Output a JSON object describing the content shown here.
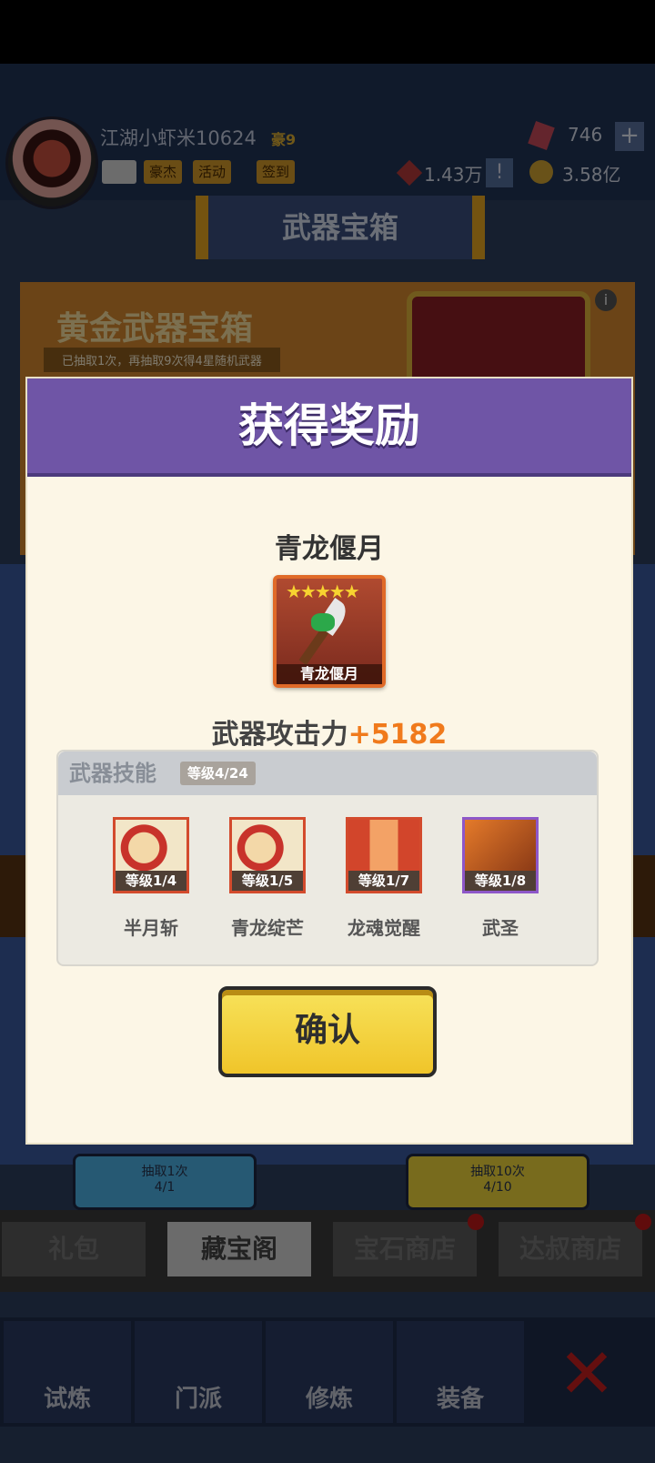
{
  "header": {
    "username": "江湖小虾米10624",
    "vip": "豪9",
    "chips": [
      "豪杰",
      "活动",
      "签到"
    ],
    "gems": "746",
    "plus_label": "+",
    "power": "1.43万",
    "alert": "!",
    "coins": "3.58亿"
  },
  "page": {
    "title": "武器宝箱",
    "chest_title": "黄金武器宝箱",
    "chest_sub": "已抽取1次，再抽取9次得4星随机武器",
    "info": "i"
  },
  "draw": {
    "single": {
      "label": "抽取1次",
      "count": "4/1"
    },
    "ten": {
      "label": "抽取10次",
      "count": "4/10"
    }
  },
  "tabs": [
    "礼包",
    "藏宝阁",
    "宝石商店",
    "达叔商店"
  ],
  "bottom_nav": [
    "试炼",
    "门派",
    "修炼",
    "装备"
  ],
  "modal": {
    "title": "获得奖励",
    "weapon_name": "青龙偃月",
    "card_stars": "★★★★★",
    "card_caption": "青龙偃月",
    "atk_label": "武器攻击力",
    "atk_value": "+5182",
    "skills_title": "武器技能",
    "skills_level": "等级4/24",
    "skills": [
      {
        "name": "半月斩",
        "level": "等级1/4"
      },
      {
        "name": "青龙绽芒",
        "level": "等级1/5"
      },
      {
        "name": "龙魂觉醒",
        "level": "等级1/7"
      },
      {
        "name": "武圣",
        "level": "等级1/8"
      }
    ],
    "confirm": "确认"
  },
  "colors": {
    "modal_header": "#6f55a6",
    "atk_value": "#f07a1c",
    "confirm_button": "#f0c52a"
  }
}
